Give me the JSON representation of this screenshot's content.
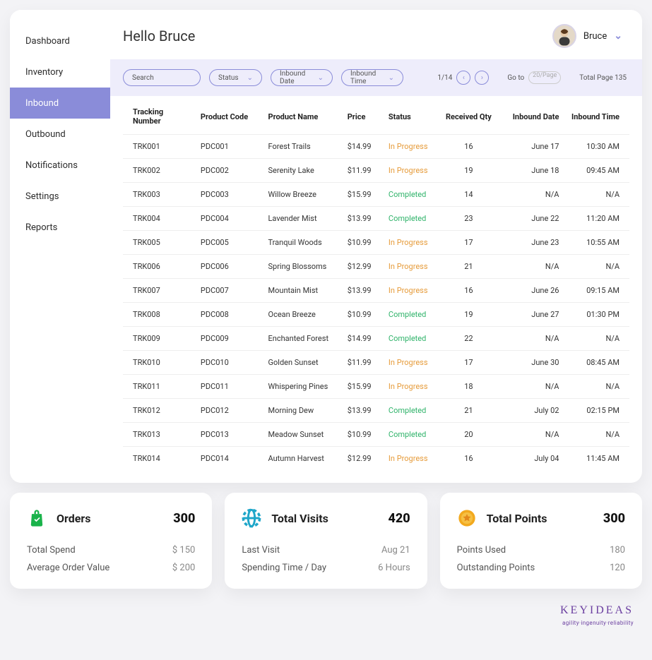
{
  "sidebar": {
    "items": [
      {
        "label": "Dashboard"
      },
      {
        "label": "Inventory"
      },
      {
        "label": "Inbound"
      },
      {
        "label": "Outbound"
      },
      {
        "label": "Notifications"
      },
      {
        "label": "Settings"
      },
      {
        "label": "Reports"
      }
    ],
    "active_index": 2
  },
  "header": {
    "greeting": "Hello Bruce",
    "username": "Bruce"
  },
  "filters": {
    "search_placeholder": "Search",
    "status_label": "Status",
    "inbound_date_label": "Inbound Date",
    "inbound_time_label": "Inbound Time",
    "page_indicator": "1/14",
    "go_to_label": "Go to",
    "go_to_placeholder": "20/Page",
    "total_page": "Total Page 135"
  },
  "table": {
    "headers": {
      "tracking": "Tracking Number",
      "code": "Product Code",
      "name": "Product Name",
      "price": "Price",
      "status": "Status",
      "qty": "Received Qty",
      "date": "Inbound Date",
      "time": "Inbound Time"
    },
    "rows": [
      {
        "tracking": "TRK001",
        "code": "PDC001",
        "name": "Forest Trails",
        "price": "$14.99",
        "status": "In Progress",
        "status_class": "st-inprog",
        "qty": "16",
        "date": "June 17",
        "time": "10:30 AM"
      },
      {
        "tracking": "TRK002",
        "code": "PDC002",
        "name": "Serenity Lake",
        "price": "$11.99",
        "status": "In Progress",
        "status_class": "st-inprog",
        "qty": "19",
        "date": "June 18",
        "time": "09:45 AM"
      },
      {
        "tracking": "TRK003",
        "code": "PDC003",
        "name": "Willow Breeze",
        "price": "$15.99",
        "status": "Completed",
        "status_class": "st-comp",
        "qty": "14",
        "date": "N/A",
        "time": "N/A"
      },
      {
        "tracking": "TRK004",
        "code": "PDC004",
        "name": "Lavender Mist",
        "price": "$13.99",
        "status": "Completed",
        "status_class": "st-comp",
        "qty": "23",
        "date": "June 22",
        "time": "11:20 AM"
      },
      {
        "tracking": "TRK005",
        "code": "PDC005",
        "name": "Tranquil Woods",
        "price": "$10.99",
        "status": "In Progress",
        "status_class": "st-inprog",
        "qty": "17",
        "date": "June 23",
        "time": "10:55 AM"
      },
      {
        "tracking": "TRK006",
        "code": "PDC006",
        "name": "Spring Blossoms",
        "price": "$12.99",
        "status": "In Progress",
        "status_class": "st-inprog",
        "qty": "21",
        "date": "N/A",
        "time": "N/A"
      },
      {
        "tracking": "TRK007",
        "code": "PDC007",
        "name": "Mountain Mist",
        "price": "$13.99",
        "status": "In Progress",
        "status_class": "st-inprog",
        "qty": "16",
        "date": "June 26",
        "time": "09:15 AM"
      },
      {
        "tracking": "TRK008",
        "code": "PDC008",
        "name": "Ocean Breeze",
        "price": "$10.99",
        "status": "Completed",
        "status_class": "st-comp",
        "qty": "19",
        "date": "June 27",
        "time": "01:30 PM"
      },
      {
        "tracking": "TRK009",
        "code": "PDC009",
        "name": "Enchanted Forest",
        "price": "$14.99",
        "status": "Completed",
        "status_class": "st-comp",
        "qty": "22",
        "date": "N/A",
        "time": "N/A"
      },
      {
        "tracking": "TRK010",
        "code": "PDC010",
        "name": "Golden Sunset",
        "price": "$11.99",
        "status": "In Progress",
        "status_class": "st-inprog",
        "qty": "17",
        "date": "June 30",
        "time": "08:45 AM"
      },
      {
        "tracking": "TRK011",
        "code": "PDC011",
        "name": "Whispering Pines",
        "price": "$15.99",
        "status": "In Progress",
        "status_class": "st-inprog",
        "qty": "18",
        "date": "N/A",
        "time": "N/A"
      },
      {
        "tracking": "TRK012",
        "code": "PDC012",
        "name": "Morning Dew",
        "price": "$13.99",
        "status": "Completed",
        "status_class": "st-comp",
        "qty": "21",
        "date": "July 02",
        "time": "02:15 PM"
      },
      {
        "tracking": "TRK013",
        "code": "PDC013",
        "name": "Meadow Sunset",
        "price": "$10.99",
        "status": "Completed",
        "status_class": "st-comp",
        "qty": "20",
        "date": "N/A",
        "time": "N/A"
      },
      {
        "tracking": "TRK014",
        "code": "PDC014",
        "name": "Autumn Harvest",
        "price": "$12.99",
        "status": "In Progress",
        "status_class": "st-inprog",
        "qty": "16",
        "date": "July 04",
        "time": "11:45 AM"
      }
    ]
  },
  "cards": {
    "orders": {
      "title": "Orders",
      "value": "300",
      "row1_label": "Total Spend",
      "row1_value": "$ 150",
      "row2_label": "Average Order Value",
      "row2_value": "$ 200"
    },
    "visits": {
      "title": "Total Visits",
      "value": "420",
      "row1_label": "Last Visit",
      "row1_value": "Aug 21",
      "row2_label": "Spending Time / Day",
      "row2_value": "6 Hours"
    },
    "points": {
      "title": "Total Points",
      "value": "300",
      "row1_label": "Points Used",
      "row1_value": "180",
      "row2_label": "Outstanding Points",
      "row2_value": "120"
    }
  },
  "footer": {
    "brand": "KEYIDEAS",
    "tag": "agility·ingenuity·reliability"
  }
}
